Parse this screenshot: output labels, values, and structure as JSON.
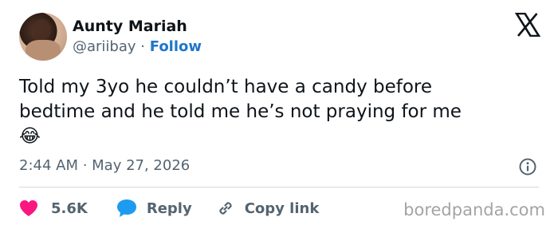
{
  "author": {
    "name": "Aunty Mariah",
    "handle": "@ariibay",
    "separator": "·",
    "follow_label": "Follow"
  },
  "tweet": {
    "text_line1": "Told my 3yo he couldn’t have a candy before",
    "text_line2": "bedtime and he told me he’s not praying for me",
    "emoji": "😂",
    "timestamp": "2:44 AM · May 27, 2026"
  },
  "actions": {
    "likes": "5.6K",
    "reply_label": "Reply",
    "copy_link_label": "Copy link"
  },
  "watermark": "boredpanda.com",
  "colors": {
    "like": "#f91880",
    "reply": "#1d9bf0",
    "follow": "#1d77c9",
    "muted": "#536471"
  },
  "icons": [
    "x-logo-icon",
    "heart-icon",
    "speech-bubble-icon",
    "link-icon",
    "info-icon"
  ]
}
